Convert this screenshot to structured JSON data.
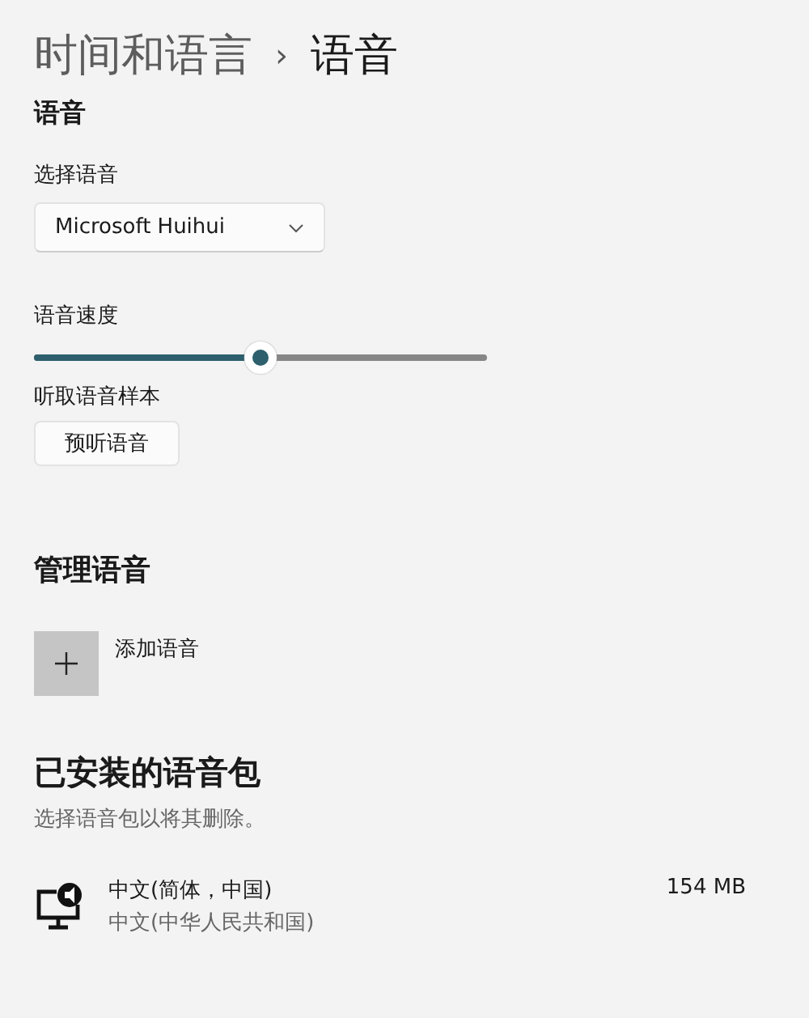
{
  "breadcrumb": {
    "parent": "时间和语言",
    "separator": "›",
    "current": "语音"
  },
  "voice": {
    "heading": "语音",
    "select_label": "选择语音",
    "selected_voice": "Microsoft Huihui",
    "speed_label": "语音速度",
    "speed": {
      "level": 0.5
    },
    "sample_label": "听取语音样本",
    "preview_button": "预听语音"
  },
  "manage": {
    "heading": "管理语音",
    "add_label": "添加语音"
  },
  "installed": {
    "heading": "已安装的语音包",
    "hint": "选择语音包以将其删除。",
    "packs": [
      {
        "name": "中文(简体，中国)",
        "region": "中文(中华人民共和国)",
        "size": "154 MB"
      }
    ]
  }
}
